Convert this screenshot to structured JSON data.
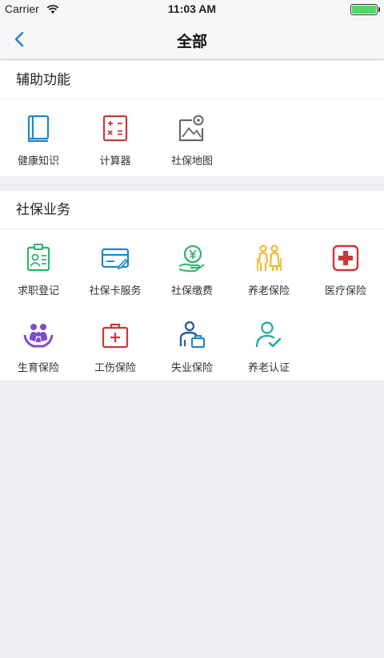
{
  "status": {
    "carrier": "Carrier",
    "time": "11:03 AM"
  },
  "nav": {
    "title": "全部"
  },
  "aux": {
    "title": "辅助功能",
    "items": [
      {
        "label": "健康知识",
        "icon": "book-icon"
      },
      {
        "label": "计算器",
        "icon": "calculator-icon"
      },
      {
        "label": "社保地图",
        "icon": "map-icon"
      }
    ]
  },
  "biz": {
    "title": "社保业务",
    "items": [
      {
        "label": "求职登记",
        "icon": "id-card-icon"
      },
      {
        "label": "社保卡服务",
        "icon": "card-icon"
      },
      {
        "label": "社保缴费",
        "icon": "payment-icon"
      },
      {
        "label": "养老保险",
        "icon": "elderly-couple-icon"
      },
      {
        "label": "医疗保险",
        "icon": "medical-cross-icon"
      },
      {
        "label": "生育保险",
        "icon": "family-icon"
      },
      {
        "label": "工伤保险",
        "icon": "first-aid-kit-icon"
      },
      {
        "label": "失业保险",
        "icon": "unemployed-person-icon"
      },
      {
        "label": "养老认证",
        "icon": "person-check-icon"
      }
    ]
  },
  "colors": {
    "blue": "#1e88c8",
    "red": "#c8383a",
    "green": "#2db36b",
    "yellow": "#f1b51d",
    "purple": "#7e4cc7",
    "teal": "#19a8a0",
    "gray": "#666666",
    "back": "#2b7cd9"
  }
}
